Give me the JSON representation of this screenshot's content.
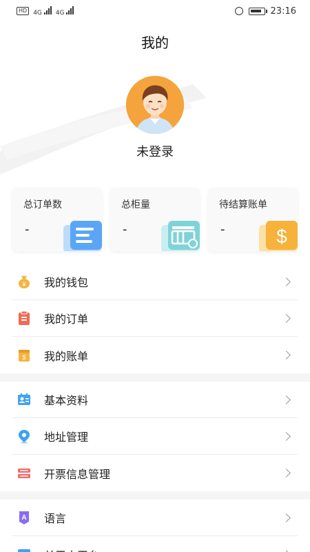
{
  "status_bar": {
    "left_badge": "HD",
    "net1": "4G",
    "net2": "4G",
    "time": "23:16"
  },
  "header": {
    "title": "我的",
    "login_status": "未登录"
  },
  "stats": [
    {
      "label": "总订单数",
      "value": "-",
      "accent": "#5aa6f5",
      "icon": "order-doc-icon"
    },
    {
      "label": "总柜量",
      "value": "-",
      "accent": "#7fd3d8",
      "icon": "container-icon"
    },
    {
      "label": "待结算账单",
      "value": "-",
      "accent": "#f6b23a",
      "icon": "dollar-icon"
    }
  ],
  "menu": {
    "group1": [
      {
        "label": "我的钱包",
        "icon": "wallet-icon",
        "color": "#f3b53f"
      },
      {
        "label": "我的订单",
        "icon": "order-clipboard-icon",
        "color": "#f06a56"
      },
      {
        "label": "我的账单",
        "icon": "bill-icon",
        "color": "#f5b440"
      }
    ],
    "group2": [
      {
        "label": "基本资料",
        "icon": "profile-card-icon",
        "color": "#3fa3f0"
      },
      {
        "label": "地址管理",
        "icon": "location-pin-icon",
        "color": "#3fa3f0"
      },
      {
        "label": "开票信息管理",
        "icon": "invoice-icon",
        "color": "#f06a6a"
      }
    ],
    "group3": [
      {
        "label": "语言",
        "icon": "language-icon",
        "color": "#8b6cf0"
      },
      {
        "label": "关于本平台",
        "icon": "about-icon",
        "color": "#3fa3f0"
      }
    ]
  }
}
